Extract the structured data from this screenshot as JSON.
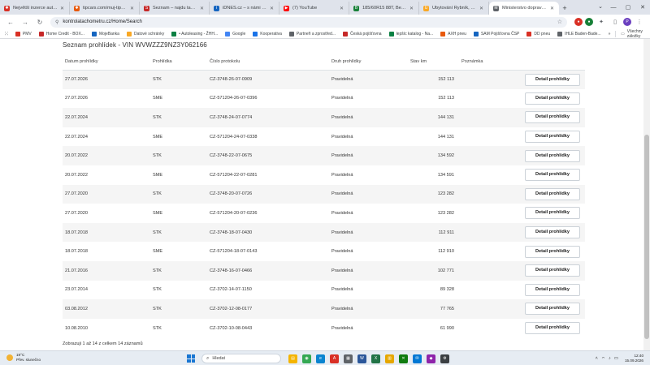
{
  "browser": {
    "tabs": [
      {
        "title": "Největší inzerce autobazarů",
        "color": "#d93025",
        "glyph": "✱",
        "active": false
      },
      {
        "title": "tipcars.com/muj-tipcars/i",
        "color": "#e8590c",
        "glyph": "✱",
        "active": false
      },
      {
        "title": "Seznam – najdu tam, co",
        "color": "#c62828",
        "glyph": "S",
        "active": false
      },
      {
        "title": "iDNES.cz – s námi víte ví",
        "color": "#1565c0",
        "glyph": "i",
        "active": false
      },
      {
        "title": "(7) YouTube",
        "color": "#ff0000",
        "glyph": "▶",
        "active": false
      },
      {
        "title": "185/60R15 88T, Berum, H",
        "color": "#188038",
        "glyph": "B",
        "active": false
      },
      {
        "title": "Ubytování Rybník, Chotě",
        "color": "#f9a825",
        "glyph": "U",
        "active": false
      },
      {
        "title": "Ministerstvo dopravy – K",
        "color": "#5f6368",
        "glyph": "M",
        "active": true
      }
    ],
    "new_tab": "+",
    "url": "kontrolatachometru.cz/Home/Search"
  },
  "bookmarks": [
    {
      "label": "PMV",
      "color": "#d93025"
    },
    {
      "label": "Home Credit - BOX...",
      "color": "#c62828"
    },
    {
      "label": "MojeBanka",
      "color": "#1565c0"
    },
    {
      "label": "Datové schránky",
      "color": "#f9a825"
    },
    {
      "label": "• Autoleasing - ŽHH...",
      "color": "#0b8043"
    },
    {
      "label": "Google",
      "color": "#4285f4"
    },
    {
      "label": "Kooperativa",
      "color": "#1a73e8"
    },
    {
      "label": "Partneři a zprostřed...",
      "color": "#5f6368"
    },
    {
      "label": "Česká pojišťovna",
      "color": "#c62828"
    },
    {
      "label": "lepšíc katalog - Na...",
      "color": "#0b8043"
    },
    {
      "label": "AXH pneu",
      "color": "#e8590c"
    },
    {
      "label": "SAM Pojišťovna ČSP",
      "color": "#1565c0"
    },
    {
      "label": "DD pneu",
      "color": "#d93025"
    },
    {
      "label": "IHLE Baden-Bade...",
      "color": "#5f6368"
    }
  ],
  "bookmarks_all": "Všechny záložky",
  "page": {
    "title": "Seznam prohlídek - VIN WVWZZZ9NZ3Y062166",
    "headers": [
      "Datum prohlídky",
      "Prohlídka",
      "Číslo protokolu",
      "Druh prohlídky",
      "Stav km",
      "Poznámka",
      ""
    ],
    "button_label": "Detail prohlídky",
    "rows": [
      {
        "date": "27.07.2026",
        "type": "STK",
        "protocol": "CZ-3748-26-07-0909",
        "kind": "Pravidelná",
        "km": "152 113",
        "note": ""
      },
      {
        "date": "27.07.2026",
        "type": "SME",
        "protocol": "CZ-571204-26-07-0396",
        "kind": "Pravidelná",
        "km": "152 113",
        "note": ""
      },
      {
        "date": "22.07.2024",
        "type": "STK",
        "protocol": "CZ-3748-24-07-0774",
        "kind": "Pravidelná",
        "km": "144 131",
        "note": ""
      },
      {
        "date": "22.07.2024",
        "type": "SME",
        "protocol": "CZ-571204-24-07-0338",
        "kind": "Pravidelná",
        "km": "144 131",
        "note": ""
      },
      {
        "date": "20.07.2022",
        "type": "STK",
        "protocol": "CZ-3748-22-07-0675",
        "kind": "Pravidelná",
        "km": "134 592",
        "note": ""
      },
      {
        "date": "20.07.2022",
        "type": "SME",
        "protocol": "CZ-571204-22-07-0281",
        "kind": "Pravidelná",
        "km": "134 591",
        "note": ""
      },
      {
        "date": "27.07.2020",
        "type": "STK",
        "protocol": "CZ-3748-20-07-0726",
        "kind": "Pravidelná",
        "km": "123 282",
        "note": ""
      },
      {
        "date": "27.07.2020",
        "type": "SME",
        "protocol": "CZ-571204-20-07-0236",
        "kind": "Pravidelná",
        "km": "123 282",
        "note": ""
      },
      {
        "date": "18.07.2018",
        "type": "STK",
        "protocol": "CZ-3748-18-07-0430",
        "kind": "Pravidelná",
        "km": "112 911",
        "note": ""
      },
      {
        "date": "18.07.2018",
        "type": "SME",
        "protocol": "CZ-571204-18-07-0143",
        "kind": "Pravidelná",
        "km": "112 910",
        "note": ""
      },
      {
        "date": "21.07.2016",
        "type": "STK",
        "protocol": "CZ-3748-16-07-0466",
        "kind": "Pravidelná",
        "km": "102 771",
        "note": ""
      },
      {
        "date": "23.07.2014",
        "type": "STK",
        "protocol": "CZ-3702-14-07-1150",
        "kind": "Pravidelná",
        "km": "89 328",
        "note": ""
      },
      {
        "date": "03.08.2012",
        "type": "STK",
        "protocol": "CZ-3702-12-08-0177",
        "kind": "Pravidelná",
        "km": "77 765",
        "note": ""
      },
      {
        "date": "10.08.2010",
        "type": "STK",
        "protocol": "CZ-3702-10-08-0443",
        "kind": "Pravidelná",
        "km": "61 990",
        "note": ""
      }
    ],
    "footer": "Zobrazuji 1 až 14 z celkem 14 záznamů"
  },
  "taskbar": {
    "weather_temp": "19°C",
    "weather_desc": "Přev. slunečno",
    "search_placeholder": "Hledat",
    "apps": [
      {
        "name": "file-explorer-icon",
        "color": "#f4b400",
        "glyph": "▤"
      },
      {
        "name": "chrome-icon",
        "color": "#34a853",
        "glyph": "◉"
      },
      {
        "name": "edge-icon",
        "color": "#0a84d0",
        "glyph": "e"
      },
      {
        "name": "acrobat-icon",
        "color": "#d93025",
        "glyph": "A"
      },
      {
        "name": "store-icon",
        "color": "#5f6368",
        "glyph": "▦"
      },
      {
        "name": "word-icon",
        "color": "#2b579a",
        "glyph": "W"
      },
      {
        "name": "excel-icon",
        "color": "#217346",
        "glyph": "X"
      },
      {
        "name": "explorer-icon",
        "color": "#e6a700",
        "glyph": "▥"
      },
      {
        "name": "xbox-icon",
        "color": "#107c10",
        "glyph": "✕"
      },
      {
        "name": "mail-icon",
        "color": "#0078d4",
        "glyph": "✉"
      },
      {
        "name": "game-icon",
        "color": "#8e24aa",
        "glyph": "◆"
      },
      {
        "name": "settings-icon",
        "color": "#3c4043",
        "glyph": "⚙"
      }
    ],
    "time": "12:40",
    "date": "15.09.2026"
  }
}
